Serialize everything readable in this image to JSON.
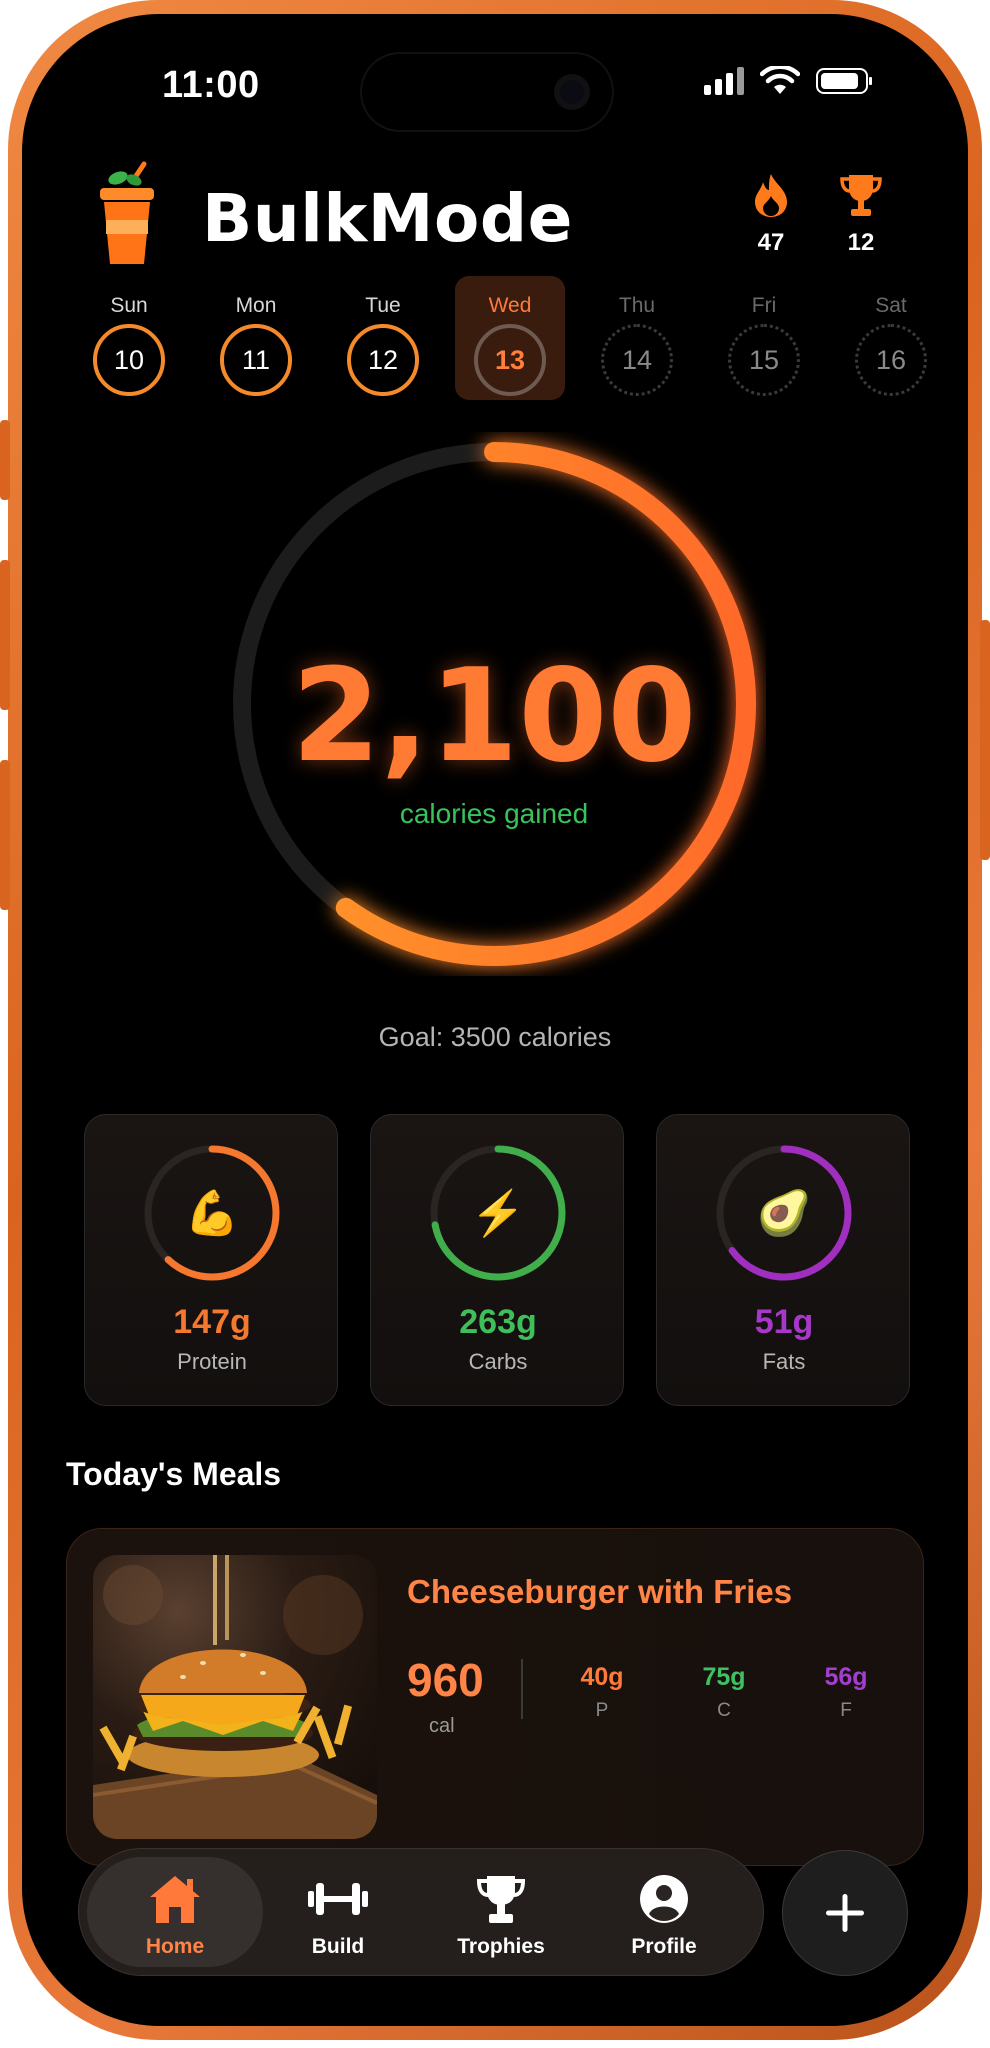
{
  "status_bar": {
    "time": "11:00"
  },
  "app": {
    "title": "BulkMode",
    "logo_icon": "smoothie-cup-icon"
  },
  "header_stats": {
    "streak": "47",
    "trophies": "12"
  },
  "week": [
    {
      "name": "Sun",
      "date": "10",
      "state": "done"
    },
    {
      "name": "Mon",
      "date": "11",
      "state": "done"
    },
    {
      "name": "Tue",
      "date": "12",
      "state": "done"
    },
    {
      "name": "Wed",
      "date": "13",
      "state": "today"
    },
    {
      "name": "Thu",
      "date": "14",
      "state": "future"
    },
    {
      "name": "Fri",
      "date": "15",
      "state": "future"
    },
    {
      "name": "Sat",
      "date": "16",
      "state": "future"
    }
  ],
  "calories": {
    "value": "2,100",
    "label": "calories gained",
    "goal_text": "Goal: 3500 calories",
    "progress": 0.6
  },
  "macros": [
    {
      "value": "147g",
      "name": "Protein",
      "icon": "flexed-biceps-emoji",
      "emoji": "💪",
      "color": "#f5782e",
      "progress": 0.62
    },
    {
      "value": "263g",
      "name": "Carbs",
      "icon": "lightning-emoji",
      "emoji": "⚡",
      "color": "#3fae4b",
      "progress": 0.72
    },
    {
      "value": "51g",
      "name": "Fats",
      "icon": "avocado-emoji",
      "emoji": "🥑",
      "color": "#a02fc0",
      "progress": 0.65
    }
  ],
  "meals_title": "Today's Meals",
  "meal": {
    "name": "Cheeseburger with Fries",
    "calories": "960",
    "cal_unit": "cal",
    "protein": {
      "value": "40g",
      "label": "P",
      "color": "#ff7a3a"
    },
    "carbs": {
      "value": "75g",
      "label": "C",
      "color": "#3fc063"
    },
    "fats": {
      "value": "56g",
      "label": "F",
      "color": "#a33fd0"
    }
  },
  "tabs": [
    {
      "label": "Home",
      "icon": "home-icon",
      "active": true
    },
    {
      "label": "Build",
      "icon": "dumbbell-icon",
      "active": false
    },
    {
      "label": "Trophies",
      "icon": "trophy-icon",
      "active": false
    },
    {
      "label": "Profile",
      "icon": "profile-icon",
      "active": false
    }
  ],
  "fab": {
    "icon": "plus-icon"
  },
  "colors": {
    "accent": "#ff7a33",
    "green": "#37c45a",
    "background": "#000000",
    "frame": "#e8793a"
  }
}
